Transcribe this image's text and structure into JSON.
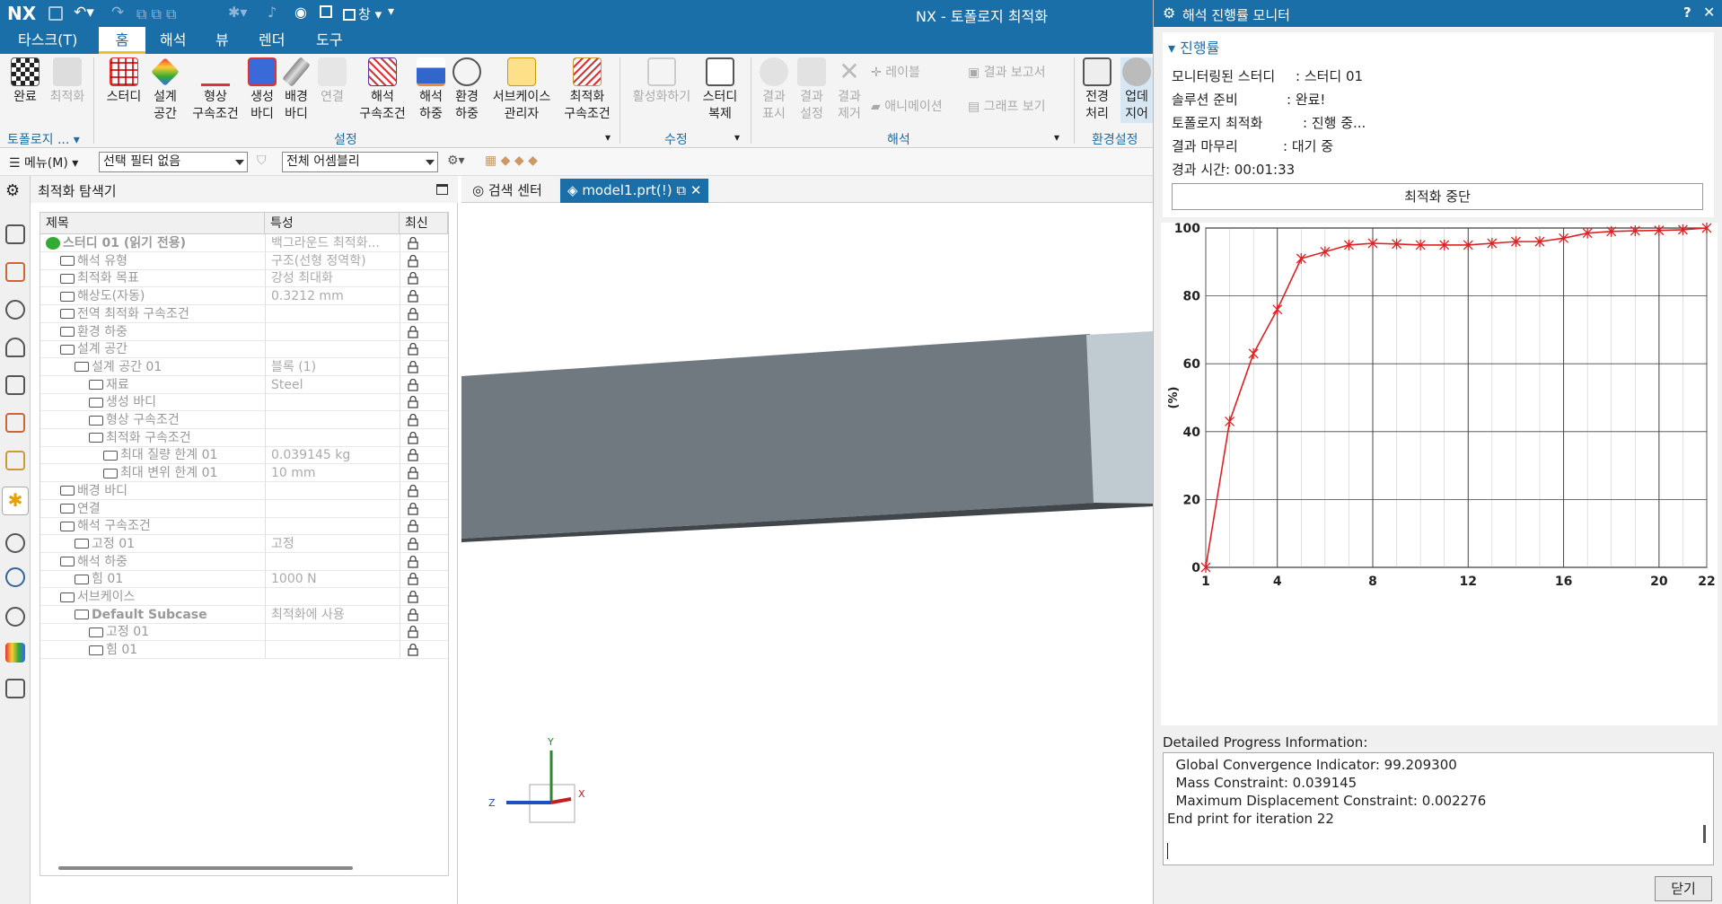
{
  "app": {
    "logo": "NX",
    "title": "NX - 토폴로지 최적화",
    "window_label": "창"
  },
  "menu_tabs": [
    {
      "label": "타스크(T)"
    },
    {
      "label": "홈"
    },
    {
      "label": "해석"
    },
    {
      "label": "뷰"
    },
    {
      "label": "렌더"
    },
    {
      "label": "도구"
    }
  ],
  "ribbon": {
    "buttons": [
      {
        "label": "완료",
        "icon": "checkered-flag-icon"
      },
      {
        "label": "최적화",
        "icon": "wand-icon"
      },
      {
        "label": "스터디",
        "icon": "grid-icon"
      },
      {
        "label": "설계\n공간",
        "icon": "design-space-icon"
      },
      {
        "label": "형상\n구속조건",
        "icon": "curve-icon"
      },
      {
        "label": "생성\n바디",
        "icon": "cube-icon"
      },
      {
        "label": "배경\n바디",
        "icon": "cylinder-icon"
      },
      {
        "label": "연결",
        "icon": "connection-icon"
      },
      {
        "label": "해석\n구속조건",
        "icon": "constraint-icon"
      },
      {
        "label": "해석\n하중",
        "icon": "load-icon"
      },
      {
        "label": "환경\n하중",
        "icon": "environment-icon"
      },
      {
        "label": "서브케이스\n관리자",
        "icon": "subcase-icon"
      },
      {
        "label": "최적화\n구속조건",
        "icon": "opt-constraint-icon"
      },
      {
        "label": "활성화하기",
        "icon": "activate-icon"
      },
      {
        "label": "스터디\n복제",
        "icon": "clone-icon"
      },
      {
        "label": "결과\n표시",
        "icon": "result-show-icon"
      },
      {
        "label": "결과\n설정",
        "icon": "result-settings-icon"
      },
      {
        "label": "결과\n제거",
        "icon": "remove-icon"
      },
      {
        "label": "전경\n처리",
        "icon": "preprocess-icon"
      },
      {
        "label": "업데\n지어",
        "icon": "update-icon"
      }
    ],
    "small_buttons": [
      {
        "label": "레이블"
      },
      {
        "label": "애니메이션"
      },
      {
        "label": "결과 보고서"
      },
      {
        "label": "그래프 보기"
      }
    ],
    "groups": [
      {
        "label": "토폴로지 ..."
      },
      {
        "label": "설정"
      },
      {
        "label": "수정"
      },
      {
        "label": "해석"
      },
      {
        "label": "환경설정"
      }
    ]
  },
  "filterbar": {
    "menu_label": "메뉴(M)",
    "selection_filter": "선택 필터 없음",
    "assembly": "전체 어셈블리"
  },
  "navigator": {
    "title": "최적화 탐색기",
    "columns": [
      "제목",
      "특성",
      "최신"
    ],
    "rows": [
      {
        "title": "스터디 01 (읽기 전용)",
        "prop": "백그라운드 최적화...",
        "level": 0
      },
      {
        "title": "해석 유형",
        "prop": "구조(선형 정역학)",
        "level": 1
      },
      {
        "title": "최적화 목표",
        "prop": "강성 최대화",
        "level": 1
      },
      {
        "title": "해상도(자동)",
        "prop": "0.3212 mm",
        "level": 1
      },
      {
        "title": "전역 최적화 구속조건",
        "prop": "",
        "level": 1
      },
      {
        "title": "환경 하중",
        "prop": "",
        "level": 1
      },
      {
        "title": "설계 공간",
        "prop": "",
        "level": 1
      },
      {
        "title": "설계 공간 01",
        "prop": "블록 (1)",
        "level": 2
      },
      {
        "title": "재료",
        "prop": "Steel",
        "level": 3
      },
      {
        "title": "생성 바디",
        "prop": "",
        "level": 3
      },
      {
        "title": "형상 구속조건",
        "prop": "",
        "level": 3
      },
      {
        "title": "최적화 구속조건",
        "prop": "",
        "level": 3
      },
      {
        "title": "최대 질량 한계 01",
        "prop": "0.039145 kg",
        "level": 4
      },
      {
        "title": "최대 변위 한계 01",
        "prop": "10 mm",
        "level": 4
      },
      {
        "title": "배경 바디",
        "prop": "",
        "level": 1
      },
      {
        "title": "연결",
        "prop": "",
        "level": 1
      },
      {
        "title": "해석 구속조건",
        "prop": "",
        "level": 1
      },
      {
        "title": "고정 01",
        "prop": "고정",
        "level": 2
      },
      {
        "title": "해석 하중",
        "prop": "",
        "level": 1
      },
      {
        "title": "힘 01",
        "prop": "1000 N",
        "level": 2
      },
      {
        "title": "서브케이스",
        "prop": "",
        "level": 1
      },
      {
        "title": "Default Subcase",
        "prop": "최적화에 사용",
        "level": 2
      },
      {
        "title": "고정 01",
        "prop": "",
        "level": 3
      },
      {
        "title": "힘 01",
        "prop": "",
        "level": 3
      }
    ]
  },
  "viewport": {
    "tabs": [
      {
        "label": "검색 센터"
      },
      {
        "label": "model1.prt(!)"
      }
    ],
    "axes": {
      "x": "X",
      "y": "Y",
      "z": "Z"
    }
  },
  "monitor": {
    "title": "해석 진행률 모니터",
    "section": "진행률",
    "status": [
      {
        "label": "모니터링된 스터디",
        "value": ": 스터디 01"
      },
      {
        "label": "솔루션 준비",
        "value": ": 완료!"
      },
      {
        "label": "토폴로지 최적화",
        "value": ": 진행 중..."
      },
      {
        "label": "결과 마무리",
        "value": ": 대기 중"
      }
    ],
    "elapsed": "경과 시간: 00:01:33",
    "stop_button": "최적화 중단",
    "detail_label": "Detailed Progress Information:",
    "detail_lines": [
      "  Global Convergence Indicator: 99.209300",
      "  Mass Constraint: 0.039145",
      "  Maximum Displacement Constraint: 0.002276",
      "End print for iteration 22"
    ],
    "close_button": "닫기"
  },
  "chart_data": {
    "type": "line",
    "x": [
      1,
      2,
      3,
      4,
      5,
      6,
      7,
      8,
      9,
      10,
      11,
      12,
      13,
      14,
      15,
      16,
      17,
      18,
      19,
      20,
      21,
      22
    ],
    "y": [
      0,
      43,
      63,
      76,
      91,
      93,
      95,
      95.5,
      95.3,
      95,
      95,
      95,
      95.5,
      96,
      96,
      97,
      98.5,
      99,
      99.2,
      99.3,
      99.5,
      100
    ],
    "ylabel": "(%)",
    "xlabel": "",
    "xlim": [
      1,
      22
    ],
    "ylim": [
      0,
      100
    ],
    "xticks": [
      1,
      4,
      8,
      12,
      16,
      20,
      22
    ],
    "yticks": [
      0,
      20,
      40,
      60,
      80,
      100
    ],
    "color": "#e02020",
    "grid": true
  }
}
